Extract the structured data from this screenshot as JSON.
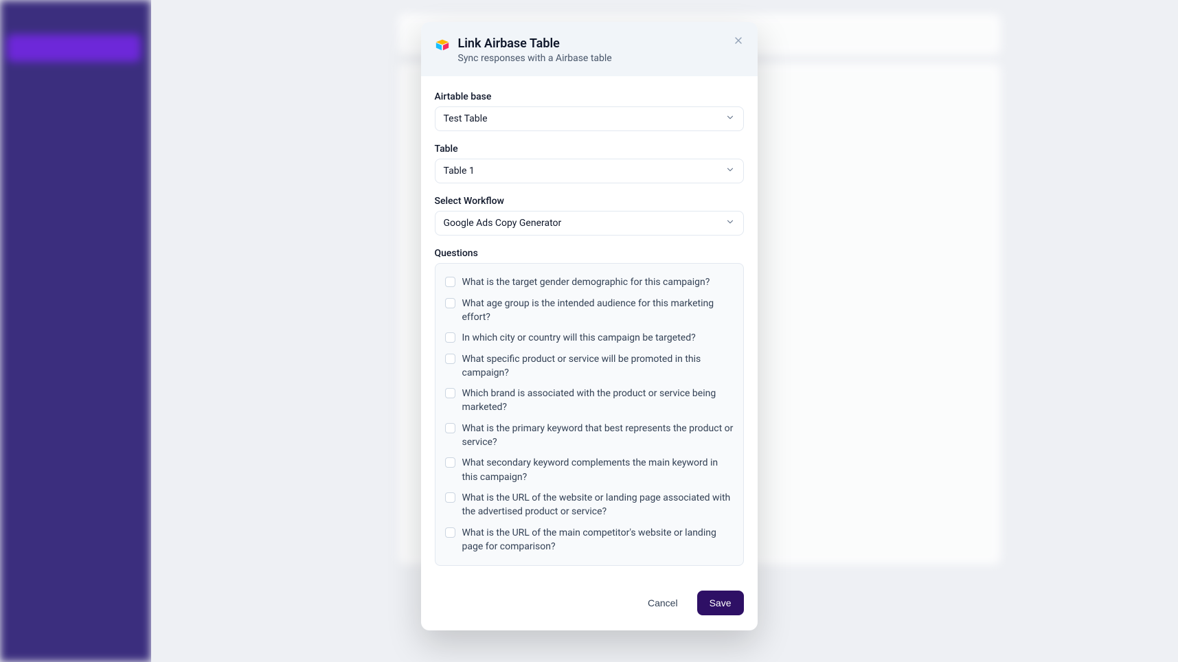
{
  "modal": {
    "title": "Link Airbase Table",
    "subtitle": "Sync responses with a Airbase table",
    "fields": {
      "base_label": "Airtable base",
      "base_value": "Test Table",
      "table_label": "Table",
      "table_value": "Table 1",
      "workflow_label": "Select Workflow",
      "workflow_value": "Google Ads Copy Generator",
      "questions_label": "Questions"
    },
    "questions": [
      "What is the target gender demographic for this campaign?",
      "What age group is the intended audience for this marketing effort?",
      "In which city or country will this campaign be targeted?",
      "What specific product or service will be promoted in this campaign?",
      "Which brand is associated with the product or service being marketed?",
      "What is the primary keyword that best represents the product or service?",
      "What secondary keyword complements the main keyword in this campaign?",
      "What is the URL of the website or landing page associated with the advertised product or service?",
      "What is the URL of the main competitor's website or landing page for comparison?"
    ],
    "actions": {
      "cancel": "Cancel",
      "save": "Save"
    }
  }
}
